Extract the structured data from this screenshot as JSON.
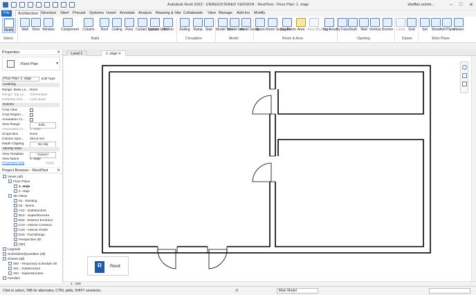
{
  "window": {
    "title": "Autodesk Revit 2023 - UNREGISTERED VERSION - RevitTest - Floor Plan: 1. etaje",
    "user": "sheffen.ochmi..."
  },
  "tabs": [
    "File",
    "Architecture",
    "Structure",
    "Steel",
    "Precast",
    "Systems",
    "Insert",
    "Annotate",
    "Analyze",
    "Massing & Site",
    "Collaborate",
    "View",
    "Manage",
    "Add-Ins",
    "Modify"
  ],
  "ribbon": {
    "tools": [
      "Modify",
      "Wall",
      "Door",
      "Window",
      "Component",
      "Column",
      "Roof",
      "Ceiling",
      "Floor",
      "Curtain System",
      "Curtain Grid",
      "Mullion",
      "Railing",
      "Ramp",
      "Stair",
      "Model Text",
      "Model Line",
      "Model Group",
      "Room",
      "Room Separator",
      "Tag Room",
      "Area",
      "Area Boundary",
      "Tag Area",
      "By Face",
      "Shaft",
      "Wall",
      "Vertical",
      "Dormer",
      "Level",
      "Grid",
      "Set",
      "Show",
      "Ref Plane",
      "Viewer"
    ],
    "groups": [
      "Select",
      "Build",
      "Circulation",
      "Model",
      "Room & Area",
      "Opening",
      "Datum",
      "Work Plane"
    ]
  },
  "properties": {
    "title": "Properties",
    "type_name": "Floor Plan",
    "selector": "Floor Plan: 1. etaje",
    "edit_type": "Edit Type",
    "help": "Properties help",
    "apply": "Apply",
    "rows": [
      {
        "section": "Underlay"
      },
      {
        "k": "Range: Base Le...",
        "v": "None"
      },
      {
        "k": "Range: Top Le...",
        "v": "Unbounded"
      },
      {
        "k": "Underlay Orie...",
        "v": "Look down"
      },
      {
        "section": "Extents"
      },
      {
        "k": "Crop View",
        "v": ""
      },
      {
        "k": "Crop Region ...",
        "v": ""
      },
      {
        "k": "Annotation Cr...",
        "v": ""
      },
      {
        "k": "View Range",
        "v": "Edit..."
      },
      {
        "k": "Associated Le...",
        "v": "1. etaje"
      },
      {
        "k": "Scope Box",
        "v": "None"
      },
      {
        "k": "Column Sym...",
        "v": "304.8 mm"
      },
      {
        "k": "Depth Clipping",
        "v": "No clip"
      },
      {
        "section": "Identity Data"
      },
      {
        "k": "View Template",
        "v": "<None>"
      },
      {
        "k": "View Name",
        "v": "1. etaje"
      }
    ]
  },
  "browser": {
    "title": "Project Browser - RevitTest",
    "items": [
      {
        "t": "Views (all)",
        "lvl": 0
      },
      {
        "t": "Floor Plans",
        "lvl": 1
      },
      {
        "t": "1. etaje",
        "lvl": 2
      },
      {
        "t": "2. etaje",
        "lvl": 2
      },
      {
        "t": "3D Views",
        "lvl": 1
      },
      {
        "t": "01 - Existing",
        "lvl": 2
      },
      {
        "t": "02 - Demo",
        "lvl": 2
      },
      {
        "t": "A10 - Substructure",
        "lvl": 2
      },
      {
        "t": "B10 - Superstructure",
        "lvl": 2
      },
      {
        "t": "B20 - Exterior Enclosur",
        "lvl": 2
      },
      {
        "t": "C10 - Interior Construc",
        "lvl": 2
      },
      {
        "t": "C20 - Interior Finish",
        "lvl": 2
      },
      {
        "t": "E20 - Furnishings",
        "lvl": 2
      },
      {
        "t": "Perspective 3D",
        "lvl": 2
      },
      {
        "t": "{3D}",
        "lvl": 2
      },
      {
        "t": "Legends",
        "lvl": 0
      },
      {
        "t": "Schedules/Quantities (all)",
        "lvl": 0
      },
      {
        "t": "Sheets (all)",
        "lvl": 0
      },
      {
        "t": "000 - Temporary Schedule Sh",
        "lvl": 1
      },
      {
        "t": "101 - Substructure",
        "lvl": 1
      },
      {
        "t": "102 - Superstructure",
        "lvl": 1
      },
      {
        "t": "Families",
        "lvl": 0
      }
    ]
  },
  "view_tabs": [
    "Level 1",
    "1. etaje"
  ],
  "logo": {
    "text": "Revit",
    "badge": "R"
  },
  "viewbar": {
    "scale": "1 : 100"
  },
  "status": {
    "hint": "Click to select, TAB for alternates, CTRL adds, SHIFT unselects.",
    "zero": ":0",
    "model": "Main Model"
  }
}
